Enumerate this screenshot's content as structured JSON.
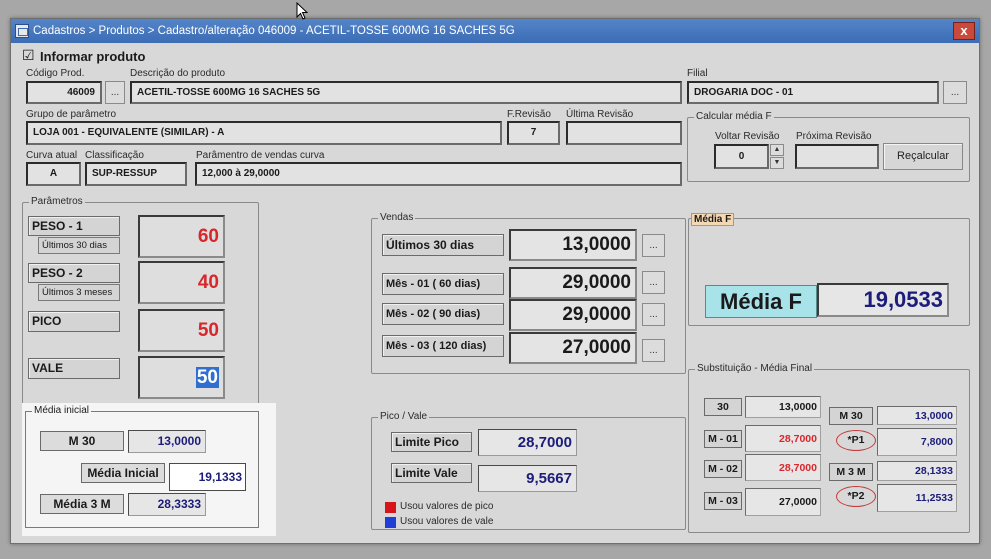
{
  "window": {
    "title": "Cadastros > Produtos > Cadastro/alteração  046009 - ACETIL-TOSSE 600MG 16 SACHES 5G",
    "close_glyph": "x"
  },
  "informar": {
    "checkbox_mark": "☑",
    "label": "Informar produto"
  },
  "produto": {
    "codigo_label": "Código Prod.",
    "codigo_value": "46009",
    "descricao_label": "Descrição do  produto",
    "descricao_value": "ACETIL-TOSSE 600MG 16 SACHES 5G",
    "filial_label": "Filial",
    "filial_value": "DROGARIA DOC - 01",
    "grupo_label": "Grupo de parâmetro",
    "grupo_value": "LOJA 001 - EQUIVALENTE (SIMILAR) - A",
    "frevisao_label": "F.Revisão",
    "frevisao_value": "7",
    "ultima_revisao_label": "Última Revisão",
    "ultima_revisao_value": "",
    "curva_label": "Curva atual",
    "curva_value": "A",
    "classificacao_label": "Classificação",
    "classificacao_value": "SUP-RESSUP",
    "param_curva_label": "Parâmentro de vendas curva",
    "param_curva_value": "12,000   à   29,0000",
    "dots": "..."
  },
  "calcular": {
    "title": "Calcular média F",
    "voltar_label": "Voltar Revisão",
    "voltar_value": "0",
    "proxima_label": "Próxima Revisão",
    "proxima_value": "",
    "recalcular_label": "Reçalcular",
    "spin_up": "▲",
    "spin_down": "▼"
  },
  "parametros": {
    "title": "Parâmetros",
    "items": [
      {
        "label": "PESO - 1",
        "sub": "Últimos 30 dias",
        "value": "60"
      },
      {
        "label": "PESO - 2",
        "sub": "Últimos 3 meses",
        "value": "40"
      },
      {
        "label": "PICO",
        "sub": "",
        "value": "50"
      },
      {
        "label": "VALE",
        "sub": "",
        "value": "50"
      }
    ]
  },
  "vendas": {
    "title": "Vendas",
    "rows": [
      {
        "label": "Últimos 30 dias",
        "value": "13,0000"
      },
      {
        "label": "Mês - 01 ( 60 dias)",
        "value": "29,0000"
      },
      {
        "label": "Mês - 02 ( 90 dias)",
        "value": "29,0000"
      },
      {
        "label": "Mês - 03 ( 120 dias)",
        "value": "27,0000"
      }
    ]
  },
  "media_f": {
    "title": "Média F",
    "label": "Média F",
    "value": "19,0533"
  },
  "media_inicial": {
    "title": "Média inicial",
    "m30_label": "M 30",
    "m30_value": "13,0000",
    "inicial_label": "Média Inicial",
    "inicial_value": "19,1333",
    "m3_label": "Média 3 M",
    "m3_value": "28,3333"
  },
  "pico_vale": {
    "title": "Pico / Vale",
    "pico_label": "Limite Pico",
    "pico_value": "28,7000",
    "vale_label": "Limite Vale",
    "vale_value": "9,5667",
    "legend_pico": "Usou valores de pico",
    "legend_pico_color": "#d8141b",
    "legend_vale": "Usou valores de vale",
    "legend_vale_color": "#1f3fd6"
  },
  "substituicao": {
    "title": "Substituição - Média Final",
    "left": [
      {
        "label": "30",
        "value": "13,0000",
        "red": false
      },
      {
        "label": "M - 01",
        "value": "28,7000",
        "red": true
      },
      {
        "label": "M - 02",
        "value": "28,7000",
        "red": true
      },
      {
        "label": "M - 03",
        "value": "27,0000",
        "red": false
      }
    ],
    "right": [
      {
        "label": "M 30",
        "value": "13,0000",
        "oval": false
      },
      {
        "label": "*P1",
        "value": "7,8000",
        "oval": true
      },
      {
        "label": "M 3 M",
        "value": "28,1333",
        "oval": false
      },
      {
        "label": "*P2",
        "value": "11,2533",
        "oval": true
      }
    ]
  }
}
